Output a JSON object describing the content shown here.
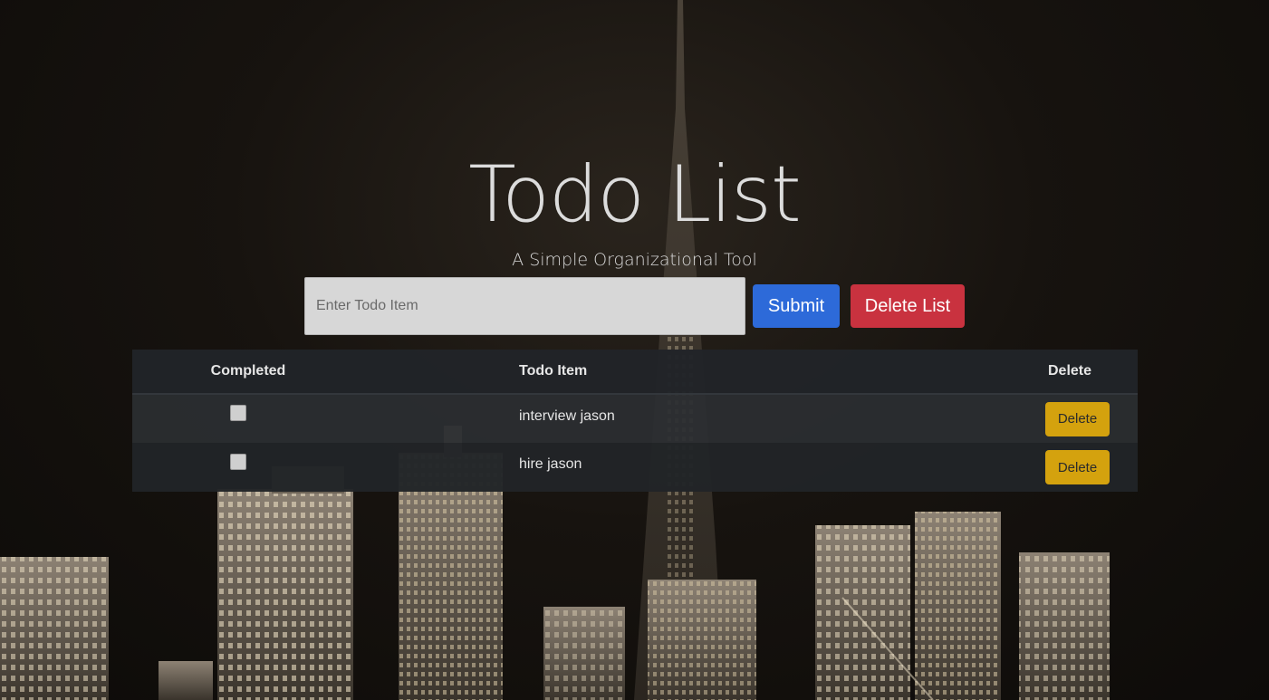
{
  "header": {
    "title": "Todo List",
    "subtitle": "A Simple Organizational Tool"
  },
  "form": {
    "input_placeholder": "Enter Todo Item",
    "input_value": "",
    "submit_label": "Submit",
    "delete_list_label": "Delete List"
  },
  "table": {
    "columns": [
      "Completed",
      "Todo Item",
      "Delete"
    ],
    "rows": [
      {
        "completed": false,
        "item": "interview jason",
        "delete_label": "Delete"
      },
      {
        "completed": false,
        "item": "hire jason",
        "delete_label": "Delete"
      }
    ]
  },
  "colors": {
    "submit": "#2d6ad9",
    "delete_list": "#c9323f",
    "row_delete": "#d4a20e",
    "table_bg": "#212428"
  },
  "background": {
    "icon": "city-skyline-night"
  }
}
